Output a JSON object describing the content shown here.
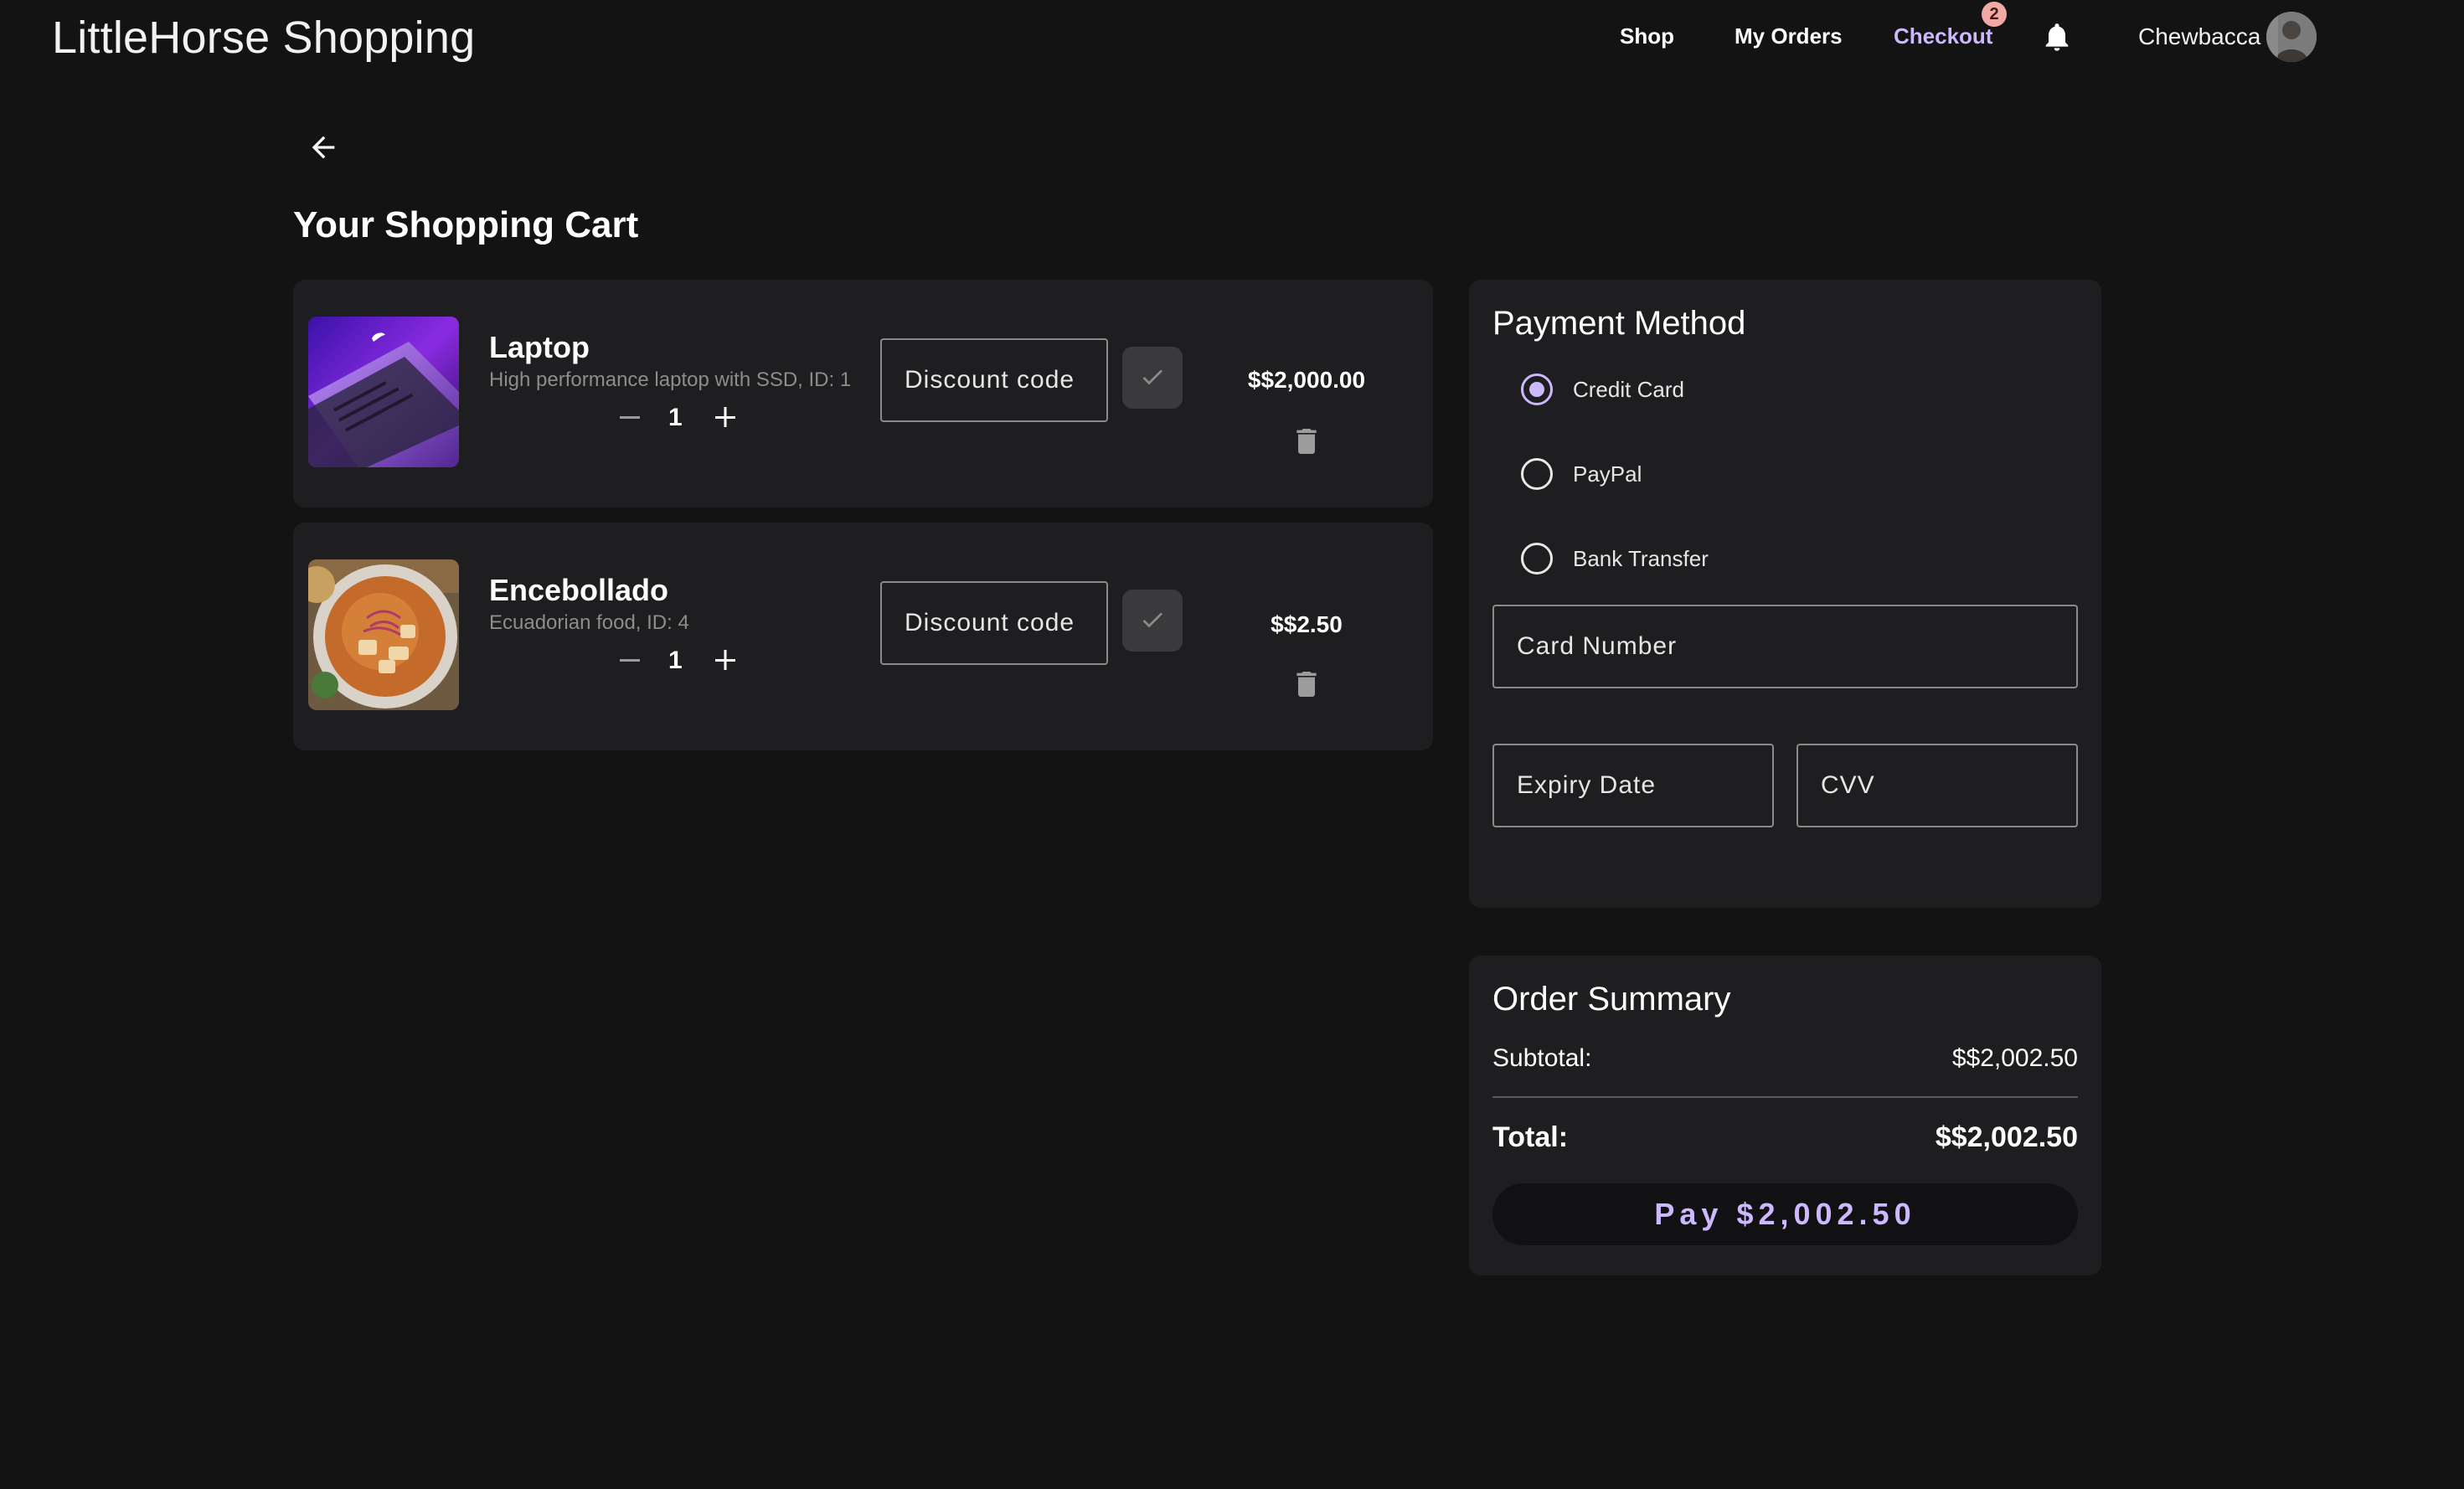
{
  "header": {
    "brand": "LittleHorse Shopping",
    "nav": {
      "shop": "Shop",
      "orders": "My Orders",
      "checkout": "Checkout"
    },
    "checkout_badge": "2",
    "username": "Chewbacca",
    "accent_color": "#cdb8ff"
  },
  "page_title": "Your Shopping Cart",
  "cart": {
    "items": [
      {
        "name": "Laptop",
        "description": "High performance laptop with SSD, ID: 1",
        "quantity": "1",
        "discount_placeholder": "Discount code",
        "price": "$$2,000.00"
      },
      {
        "name": "Encebollado",
        "description": "Ecuadorian food, ID: 4",
        "quantity": "1",
        "discount_placeholder": "Discount code",
        "price": "$$2.50"
      }
    ]
  },
  "payment": {
    "title": "Payment Method",
    "options": [
      "Credit Card",
      "PayPal",
      "Bank Transfer"
    ],
    "selected": "Credit Card",
    "card_number_placeholder": "Card Number",
    "expiry_placeholder": "Expiry Date",
    "cvv_placeholder": "CVV"
  },
  "summary": {
    "title": "Order Summary",
    "subtotal_label": "Subtotal:",
    "subtotal_value": "$$2,002.50",
    "total_label": "Total:",
    "total_value": "$$2,002.50",
    "pay_button": "Pay $2,002.50"
  },
  "icons": [
    "bell-icon",
    "avatar",
    "back-arrow-icon",
    "minus-icon",
    "plus-icon",
    "check-icon",
    "trash-icon"
  ]
}
